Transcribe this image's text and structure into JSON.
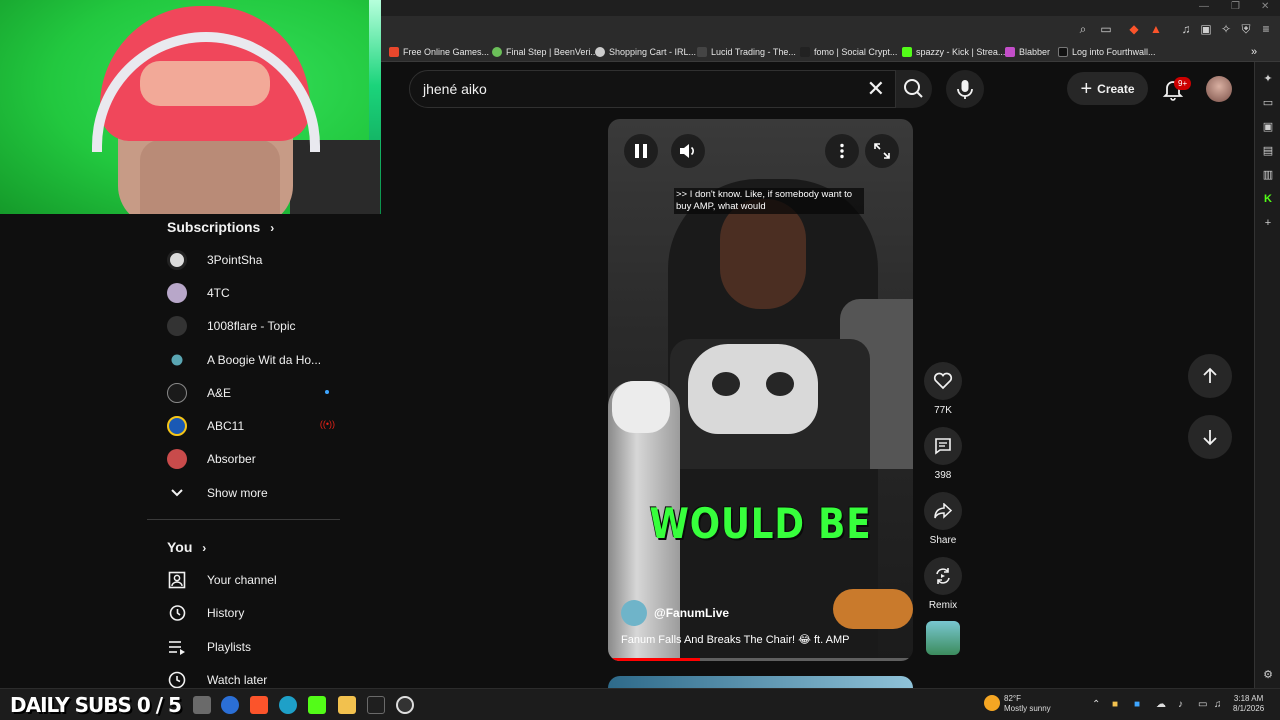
{
  "overlay": {
    "daily_subs": "DAILY SUBS 0 / 5"
  },
  "bookmarks": [
    {
      "label": "Free Online Games...",
      "color": "#e8472c"
    },
    {
      "label": "Final Step | BeenVeri...",
      "color": "#6bbf59"
    },
    {
      "label": "Shopping Cart - IRL...",
      "color": "#cccccc"
    },
    {
      "label": "Lucid Trading - The...",
      "color": "#444444"
    },
    {
      "label": "fomo | Social Crypt...",
      "color": "#222222"
    },
    {
      "label": "spazzy - Kick | Strea...",
      "color": "#53fc18"
    },
    {
      "label": "Blabber",
      "color": "#c34ec9"
    },
    {
      "label": "Log into Fourthwall...",
      "color": "#111111"
    }
  ],
  "masthead": {
    "search_query": "jhené aiko",
    "create_label": "Create",
    "notification_count": "9+"
  },
  "guide": {
    "subscriptions_title": "Subscriptions",
    "subscriptions": [
      {
        "label": "3PointSha",
        "color": "#dddddd",
        "status": ""
      },
      {
        "label": "4TC",
        "color": "#b8a7c9",
        "status": ""
      },
      {
        "label": "1008flare - Topic",
        "color": "#333333",
        "status": ""
      },
      {
        "label": "A Boogie Wit da Ho...",
        "color": "#5aa6b3",
        "status": ""
      },
      {
        "label": "A&E",
        "color": "#1a1a1a",
        "status": "new"
      },
      {
        "label": "ABC11",
        "color": "#1a59b5",
        "status": "live"
      },
      {
        "label": "Absorber",
        "color": "#c94b4b",
        "status": ""
      }
    ],
    "show_more": "Show more",
    "you_title": "You",
    "you_items": [
      {
        "label": "Your channel",
        "icon": "person-box-icon"
      },
      {
        "label": "History",
        "icon": "history-icon"
      },
      {
        "label": "Playlists",
        "icon": "playlists-icon"
      },
      {
        "label": "Watch later",
        "icon": "clock-icon"
      }
    ]
  },
  "short": {
    "caption": ">> I don't know. Like, if somebody want to buy AMP, what would",
    "overlay_text": "WOULD BE",
    "channel": "@FanumLive",
    "title": "Fanum Falls And Breaks The Chair! 😂 ft. AMP",
    "progress": 0.3
  },
  "actions": {
    "likes": "77K",
    "comments": "398",
    "share": "Share",
    "remix": "Remix"
  },
  "taskbar": {
    "temperature": "82°F",
    "condition": "Mostly sunny",
    "time": "3:18 AM",
    "date": "8/1/2026"
  },
  "colors": {
    "accent_red": "#ff0000",
    "overlay_green": "#37ff3c",
    "background": "#0f0f0f"
  }
}
